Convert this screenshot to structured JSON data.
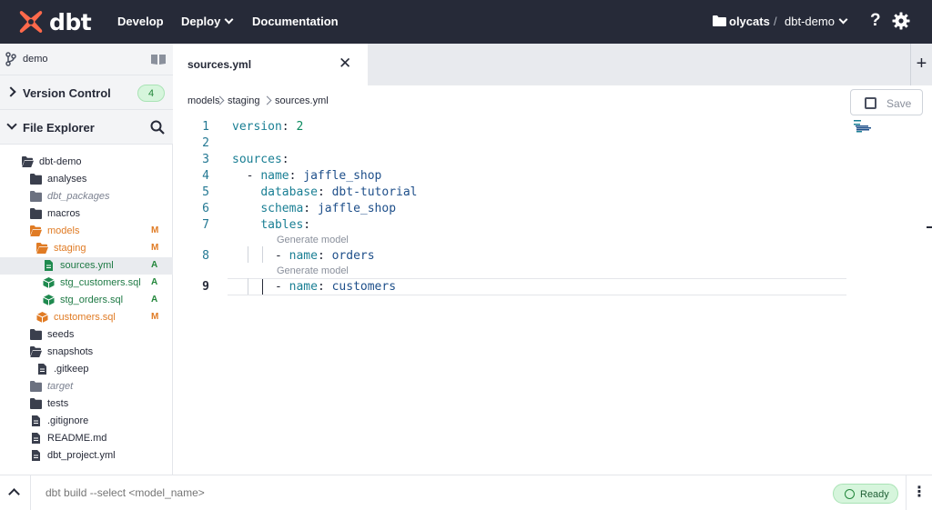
{
  "brand": {
    "logo_text": "dbt",
    "logo_color": "#ff694b"
  },
  "nav": {
    "develop": "Develop",
    "deploy": "Deploy",
    "documentation": "Documentation"
  },
  "project": {
    "account": "olycats",
    "separator": "/",
    "project": "dbt-demo"
  },
  "sidebar": {
    "branch": "demo",
    "version_control": {
      "title": "Version Control",
      "count": "4"
    },
    "file_explorer": {
      "title": "File Explorer"
    },
    "tree": [
      {
        "label": "dbt-demo",
        "kind": "folder-open",
        "status": "",
        "style": "normal"
      },
      {
        "label": "analyses",
        "kind": "folder",
        "status": "",
        "style": "normal"
      },
      {
        "label": "dbt_packages",
        "kind": "folder",
        "status": "",
        "style": "ignored"
      },
      {
        "label": "macros",
        "kind": "folder",
        "status": "",
        "style": "normal"
      },
      {
        "label": "models",
        "kind": "folder-open",
        "status": "M",
        "style": "M"
      },
      {
        "label": "staging",
        "kind": "folder-open",
        "status": "M",
        "style": "M"
      },
      {
        "label": "sources.yml",
        "kind": "file",
        "status": "A",
        "style": "A"
      },
      {
        "label": "stg_customers.sql",
        "kind": "model",
        "status": "A",
        "style": "A"
      },
      {
        "label": "stg_orders.sql",
        "kind": "model",
        "status": "A",
        "style": "A"
      },
      {
        "label": "customers.sql",
        "kind": "model",
        "status": "M",
        "style": "M"
      },
      {
        "label": "seeds",
        "kind": "folder",
        "status": "",
        "style": "normal"
      },
      {
        "label": "snapshots",
        "kind": "folder-open",
        "status": "",
        "style": "normal"
      },
      {
        "label": ".gitkeep",
        "kind": "file",
        "status": "",
        "style": "normal"
      },
      {
        "label": "target",
        "kind": "folder",
        "status": "",
        "style": "ignored"
      },
      {
        "label": "tests",
        "kind": "folder",
        "status": "",
        "style": "normal"
      },
      {
        "label": ".gitignore",
        "kind": "file",
        "status": "",
        "style": "normal"
      },
      {
        "label": "README.md",
        "kind": "file",
        "status": "",
        "style": "normal"
      },
      {
        "label": "dbt_project.yml",
        "kind": "file",
        "status": "",
        "style": "normal"
      }
    ]
  },
  "tab": {
    "label": "sources.yml",
    "close": "✕",
    "add": "+"
  },
  "path": [
    "models",
    "staging",
    "sources.yml"
  ],
  "save_label": "Save",
  "editor": {
    "codelens": "Generate model",
    "lines": [
      {
        "no": "1",
        "tokens": [
          [
            "k",
            "version"
          ],
          [
            "p",
            ": "
          ],
          [
            "n",
            "2"
          ]
        ]
      },
      {
        "no": "2",
        "tokens": []
      },
      {
        "no": "3",
        "tokens": [
          [
            "k",
            "sources"
          ],
          [
            "p",
            ":"
          ]
        ]
      },
      {
        "no": "4",
        "tokens": [
          [
            "p",
            "  - "
          ],
          [
            "k",
            "name"
          ],
          [
            "p",
            ": "
          ],
          [
            "v",
            "jaffle_shop"
          ]
        ]
      },
      {
        "no": "5",
        "tokens": [
          [
            "p",
            "    "
          ],
          [
            "k",
            "database"
          ],
          [
            "p",
            ": "
          ],
          [
            "v",
            "dbt-tutorial"
          ]
        ]
      },
      {
        "no": "6",
        "tokens": [
          [
            "p",
            "    "
          ],
          [
            "k",
            "schema"
          ],
          [
            "p",
            ": "
          ],
          [
            "v",
            "jaffle_shop"
          ]
        ]
      },
      {
        "no": "7",
        "tokens": [
          [
            "p",
            "    "
          ],
          [
            "k",
            "tables"
          ],
          [
            "p",
            ":"
          ]
        ]
      },
      {
        "no": "8",
        "tokens": [
          [
            "p",
            "      - "
          ],
          [
            "k",
            "name"
          ],
          [
            "p",
            ": "
          ],
          [
            "v",
            "orders"
          ]
        ]
      },
      {
        "no": "9",
        "tokens": [
          [
            "p",
            "      - "
          ],
          [
            "k",
            "name"
          ],
          [
            "p",
            ": "
          ],
          [
            "v",
            "customers"
          ]
        ]
      }
    ]
  },
  "command": {
    "placeholder": "dbt build --select <model_name>",
    "status": "Ready"
  },
  "colors": {
    "topbar": "#262a38",
    "modified": "#e07b24",
    "added": "#22863a",
    "ready_bg": "#d6f5dc"
  }
}
